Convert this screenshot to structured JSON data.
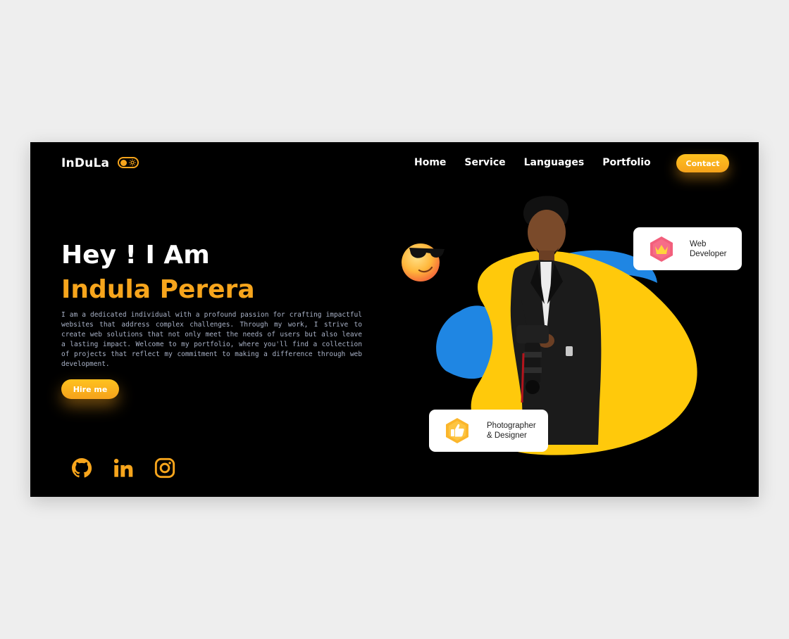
{
  "header": {
    "logo": "InDuLa",
    "theme_toggle": "theme-toggle",
    "nav": [
      "Home",
      "Service",
      "Languages",
      "Portfolio"
    ],
    "contact_label": "Contact"
  },
  "hero": {
    "greeting": "Hey ! I Am",
    "name": "Indula Perera",
    "description": "I am a dedicated individual with a profound passion for crafting impactful websites that address complex challenges. Through my work, I strive to create web solutions that not only meet the needs of users but also leave a lasting impact. Welcome to my portfolio, where you'll find a collection of projects that reflect my commitment to making a difference through web development.",
    "hire_label": "Hire me"
  },
  "cards": {
    "web_line1": "Web",
    "web_line2": "Developer",
    "photo_line1": "Photographer",
    "photo_line2": "& Designer"
  },
  "socials": [
    "github-icon",
    "linkedin-icon",
    "instagram-icon"
  ],
  "colors": {
    "accent": "#f7a51c",
    "background": "#000000",
    "blob_yellow": "#ffc90b",
    "blob_blue": "#1f86e3"
  }
}
